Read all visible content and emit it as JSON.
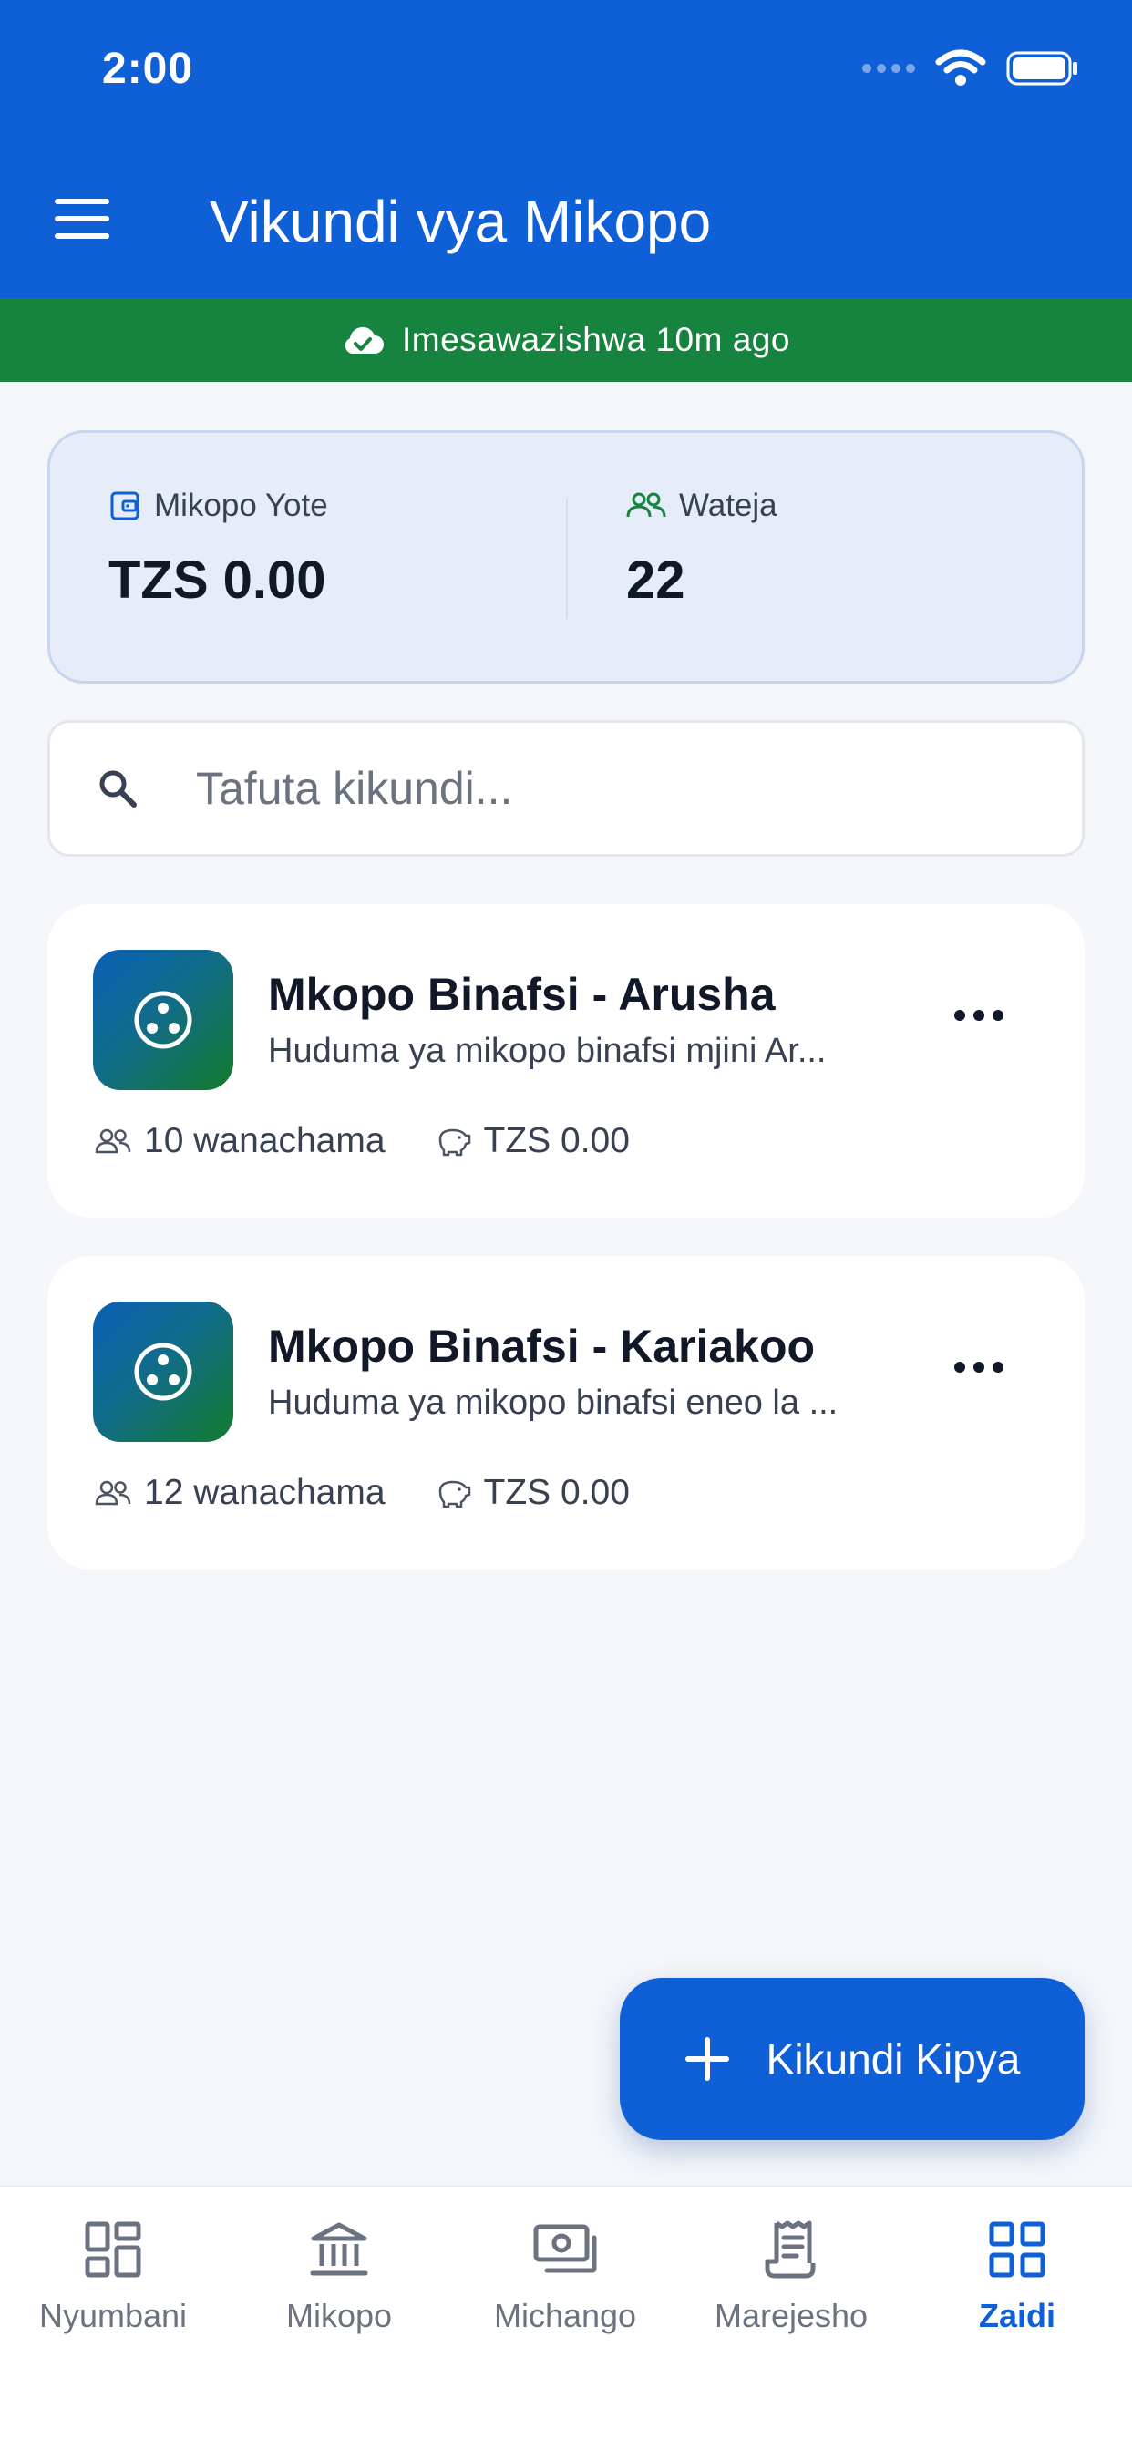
{
  "status_bar": {
    "time": "2:00"
  },
  "header": {
    "title": "Vikundi vya Mikopo"
  },
  "sync_banner": {
    "text": "Imesawazishwa 10m ago"
  },
  "stats": [
    {
      "label": "Mikopo Yote",
      "value": "TZS 0.00",
      "icon": "wallet-icon"
    },
    {
      "label": "Wateja",
      "value": "22",
      "icon": "users-icon"
    }
  ],
  "search": {
    "placeholder": "Tafuta kikundi...",
    "value": ""
  },
  "groups": [
    {
      "name": "Mkopo Binafsi - Arusha",
      "description": "Huduma ya mikopo binafsi mjini Ar...",
      "members": "10 wanachama",
      "amount": "TZS 0.00"
    },
    {
      "name": "Mkopo Binafsi - Kariakoo",
      "description": "Huduma ya mikopo binafsi eneo la ...",
      "members": "12 wanachama",
      "amount": "TZS 0.00"
    }
  ],
  "fab": {
    "label": "Kikundi Kipya"
  },
  "bottom_nav": [
    {
      "label": "Nyumbani",
      "icon": "dashboard-icon",
      "active": false
    },
    {
      "label": "Mikopo",
      "icon": "bank-icon",
      "active": false
    },
    {
      "label": "Michango",
      "icon": "cash-icon",
      "active": false
    },
    {
      "label": "Marejesho",
      "icon": "receipt-icon",
      "active": false
    },
    {
      "label": "Zaidi",
      "icon": "grid-icon",
      "active": true
    }
  ],
  "colors": {
    "primary": "#0f5fd7",
    "success_banner": "#16843f",
    "background": "#f4f6fa",
    "stats_card": "#e6edf8",
    "wateja_icon": "#16843f"
  }
}
